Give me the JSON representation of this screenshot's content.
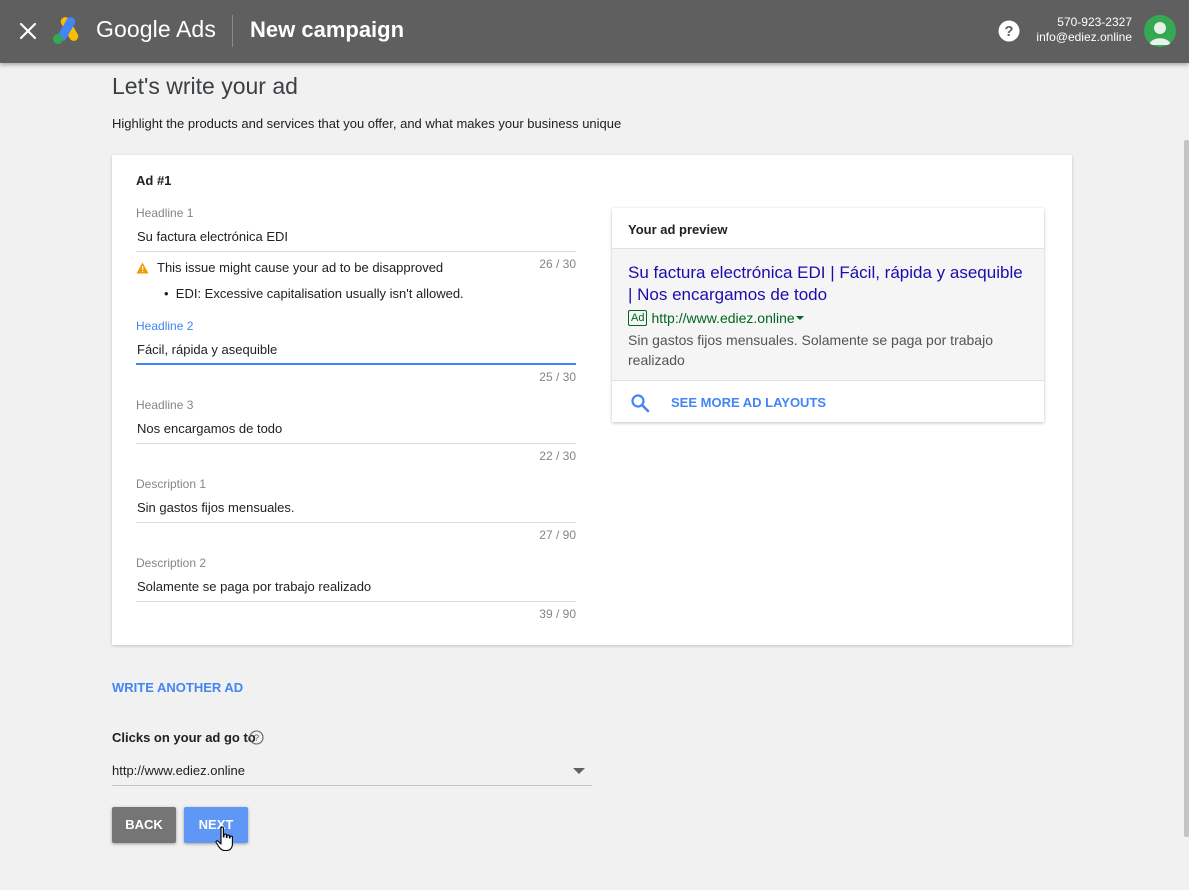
{
  "topbar": {
    "brand": "Google Ads",
    "page_title": "New campaign",
    "account_phone": "570-923-2327",
    "account_email": "info@ediez.online",
    "icons": [
      "close-icon",
      "google-ads-logo",
      "help-icon",
      "avatar"
    ]
  },
  "page": {
    "heading": "Let's write your ad",
    "subheading": "Highlight the products and services that you offer, and what makes your business unique"
  },
  "ad": {
    "title": "Ad #1",
    "fields": [
      {
        "label": "Headline 1",
        "value": "Su factura electrónica EDI",
        "count": "26 / 30"
      },
      {
        "label": "Headline 2",
        "value": "Fácil, rápida y asequible",
        "count": "25 / 30"
      },
      {
        "label": "Headline 3",
        "value": "Nos encargamos de todo",
        "count": "22 / 30"
      },
      {
        "label": "Description 1",
        "value": "Sin gastos fijos mensuales.",
        "count": "27 / 90"
      },
      {
        "label": "Description 2",
        "value": "Solamente se paga por trabajo realizado",
        "count": "39 / 90"
      }
    ],
    "warning": {
      "text": "This issue might cause your ad to be disapproved",
      "bullet": "EDI: Excessive capitalisation usually isn't allowed.",
      "color": "#f29900"
    }
  },
  "preview": {
    "title": "Your ad preview",
    "headline": "Su factura electrónica EDI | Fácil, rápida y asequible | Nos encargamos de todo",
    "ad_badge": "Ad",
    "url": "http://www.ediez.online",
    "description": "Sin gastos fijos mensuales. Solamente se paga por trabajo realizado",
    "see_more": "SEE MORE AD LAYOUTS"
  },
  "actions": {
    "write_another": "WRITE ANOTHER AD",
    "clicks_label": "Clicks on your ad go to",
    "final_url": "http://www.ediez.online",
    "back": "BACK",
    "next": "NEXT"
  },
  "colors": {
    "accent": "#4285f4",
    "topbar": "#5f5f5f",
    "link": "#1a0dab",
    "url_green": "#006621"
  }
}
